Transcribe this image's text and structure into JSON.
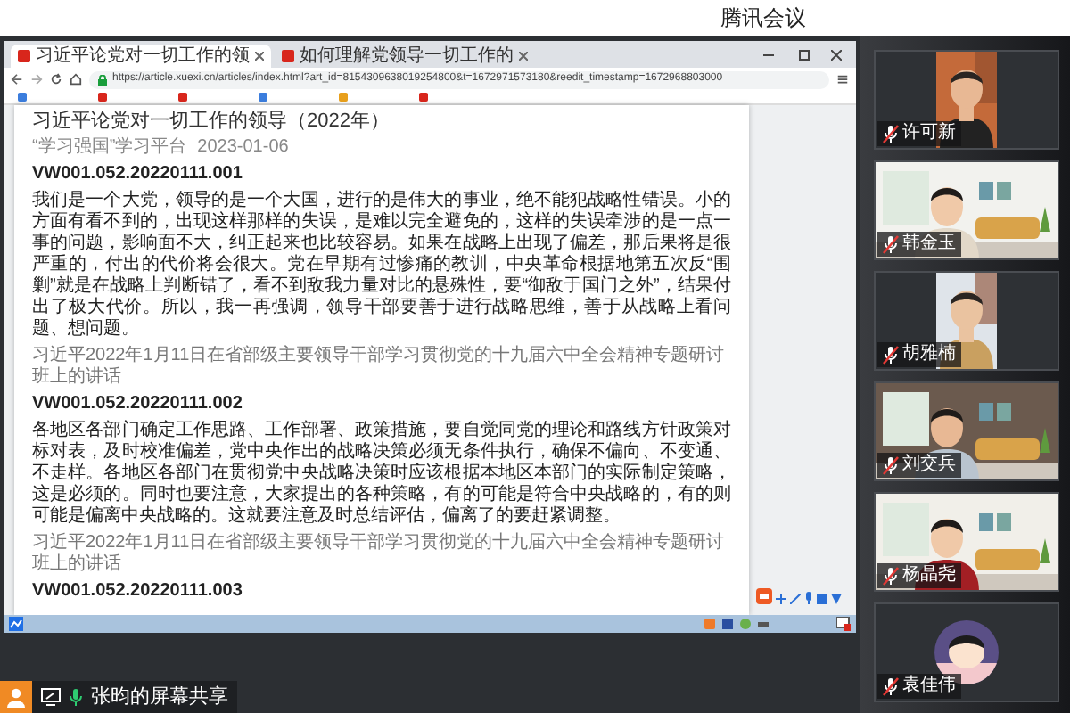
{
  "app_title": "腾讯会议",
  "browser": {
    "tabs": [
      {
        "title": "习近平论党对一切工作的领",
        "selected": true
      },
      {
        "title": "如何理解党领导一切工作的",
        "selected": false
      }
    ],
    "address": "https://article.xuexi.cn/articles/index.html?art_id=8154309638019254800&t=1672971573180&reedit_timestamp=1672968803000",
    "article": {
      "title": "习近平论党对一切工作的领导（2022年）",
      "publisher": "“学习强国”学习平台",
      "date": "2023-01-06",
      "sections": [
        {
          "kind": "heading",
          "text": "VW001.052.20220111.001"
        },
        {
          "kind": "paragraph",
          "text": "我们是一个大党，领导的是一个大国，进行的是伟大的事业，绝不能犯战略性错误。小的方面有看不到的，出现这样那样的失误，是难以完全避免的，这样的失误牵涉的是一点一事的问题，影响面不大，纠正起来也比较容易。如果在战略上出现了偏差，那后果将是很严重的，付出的代价将会很大。党在早期有过惨痛的教训，中央革命根据地第五次反“围剿”就是在战略上判断错了，看不到敌我力量对比的悬殊性，要“御敌于国门之外”，结果付出了极大代价。所以，我一再强调，领导干部要善于进行战略思维，善于从战略上看问题、想问题。"
        },
        {
          "kind": "source",
          "text": "习近平2022年1月11日在省部级主要领导干部学习贯彻党的十九届六中全会精神专题研讨班上的讲话"
        },
        {
          "kind": "heading",
          "text": "VW001.052.20220111.002"
        },
        {
          "kind": "paragraph",
          "text": "各地区各部门确定工作思路、工作部署、政策措施，要自觉同党的理论和路线方针政策对标对表，及时校准偏差，党中央作出的战略决策必须无条件执行，确保不偏向、不变通、不走样。各地区各部门在贯彻党中央战略决策时应该根据本地区本部门的实际制定策略，这是必须的。同时也要注意，大家提出的各种策略，有的可能是符合中央战略的，有的则可能是偏离中央战略的。这就要注意及时总结评估，偏离了的要赶紧调整。"
        },
        {
          "kind": "source",
          "text": "习近平2022年1月11日在省部级主要领导干部学习贯彻党的十九届六中全会精神专题研讨班上的讲话"
        },
        {
          "kind": "heading",
          "text": "VW001.052.20220111.003"
        }
      ]
    }
  },
  "screen_share": {
    "label": "张昀的屏幕共享",
    "mic_muted": false
  },
  "participants": [
    {
      "name": "许可新",
      "muted": true,
      "kind": "portrait"
    },
    {
      "name": "韩金玉",
      "muted": true,
      "kind": "wide"
    },
    {
      "name": "胡雅楠",
      "muted": true,
      "kind": "portrait"
    },
    {
      "name": "刘交兵",
      "muted": true,
      "kind": "wide"
    },
    {
      "name": "杨晶尧",
      "muted": true,
      "kind": "wide"
    },
    {
      "name": "袁佳伟",
      "muted": true,
      "kind": "avatar"
    }
  ]
}
